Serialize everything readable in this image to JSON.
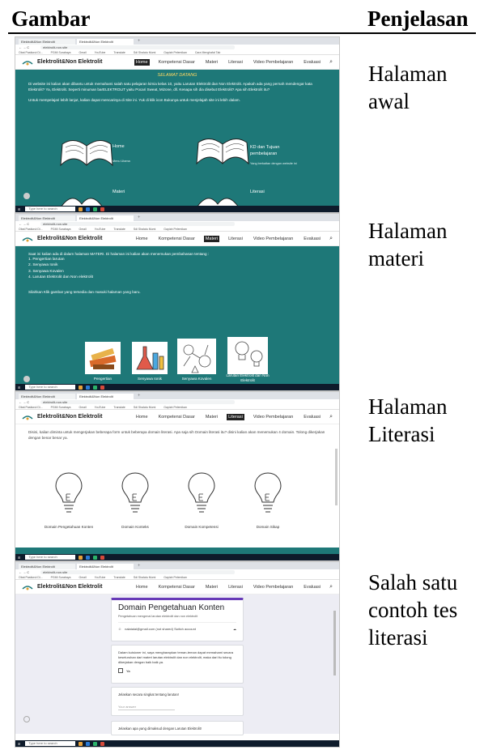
{
  "table": {
    "header_gambar": "Gambar",
    "header_penjelasan": "Penjelasan"
  },
  "rows": [
    {
      "desc": "Halaman awal"
    },
    {
      "desc": "Halaman materi"
    },
    {
      "desc": "Halaman Literasi"
    },
    {
      "desc": "Salah satu contoh tes literasi"
    }
  ],
  "site": {
    "brand": "Elektrolit&Non Elektrolit",
    "nav": [
      "Home",
      "Kompetensi Dasar",
      "Materi",
      "Literasi",
      "Video Pembelajaran",
      "Evaluasi"
    ]
  },
  "home": {
    "welcome": "SELAMAT DATANG",
    "para1": "Di website ini kalian akan dibantu untuk memahami salah satu pelajaran kimia kelas 10, yaitu Larutan Elektrolit dan Non Elektrolit. Apakah ada yang pernah mendengar kata Elektrolit? Ya, Elektrolit. Seperti minuman barELEKTROLIT yaitu Pocari Sweat, Mizone, dll. Kenapa sih dia disebut Elektrolit? Apa sih Elektrolit itu?",
    "para2": "Untuk mempelajari lebih lanjut, kalian dapat mencarinya di Site ini. Yuk di klik icon Bukunya untuk menjelajah site ini lebih dalam.",
    "card1": "Home",
    "card1_sub": "Menu Utama",
    "card2": "KD dan Tujuan pembelajaran",
    "card2_sub": "Yang berkaitan dengan website ini",
    "card3": "Materi",
    "card4": "Literasi"
  },
  "materi": {
    "intro": "Saat ini kalian ada di dalam halaman MATERI. Di halaman ini kalian akan menemukan pembahasan tentang :",
    "items": [
      "1. Pengertian larutan",
      "2. Senyawa Ionik",
      "3. Senyawa Kovalen",
      "4. Larutan Elektrolit dan Non elektrolit"
    ],
    "cta": "Silahkan Klik gambar yang tersedia dan masuki halaman yang baru.",
    "thumbs": [
      "Pengertian",
      "Senyawa Ionik",
      "Senyawa Kovalen",
      "Larutan Elektrolit dan Non Elektrolit"
    ]
  },
  "literasi": {
    "intro": "Disini, kalian diminta untuk mengerjakan beberapa form untuk beberapa domain literasi. Apa saja sih Domain literasi itu? disini kalian akan menemukan 4 domain. Tolong dikerjakan dengan benar benar ya.",
    "domains": [
      "Domain Pengetahuan Konten",
      "Domain Konteks",
      "Domain Kompetensi",
      "Domain Sikap"
    ]
  },
  "form": {
    "title": "Domain Pengetahuan Konten",
    "subtitle": "Pengetahuan mengenai larutan elektrolit dan non elektrolit",
    "account": "nalatalal@gmail.com (not shared) Switch account",
    "consent": "Dalam kuisioner ini, saya mengharapkan teman-teman dapat memahami secara keseluruhan dari materi larutan elektrolit dan non elektrolit, maka dari itu tolong dikerjakan dengan baik baik ya.",
    "check": "Ya",
    "q1": "Jelaskan secara singkat tentang larutan!",
    "answer_placeholder": "Your answer",
    "q2": "Jelaskan apa yang dimaksud dengan Larutan Elektrolit!"
  },
  "browser": {
    "tab1": "Elektrolit&Non Elektrolit",
    "tab2": "Elektrolit&Non Elektrolit",
    "url": "elektrolit-non.site",
    "bookmarks": [
      "Obat Pastiurut Di...",
      "PGMI Surabaya",
      "Gmail",
      "YouTube",
      "Translate",
      "Sdi Shalatu Mumi",
      "Gapiah Pelemikan",
      "Cara Menghafal Tab",
      "Elektrolit - untuk b",
      "Siapkan Sumua dia"
    ],
    "search": "Type here to search"
  },
  "colors": {
    "teal": "#1e7878",
    "form_accent": "#673ab7"
  }
}
